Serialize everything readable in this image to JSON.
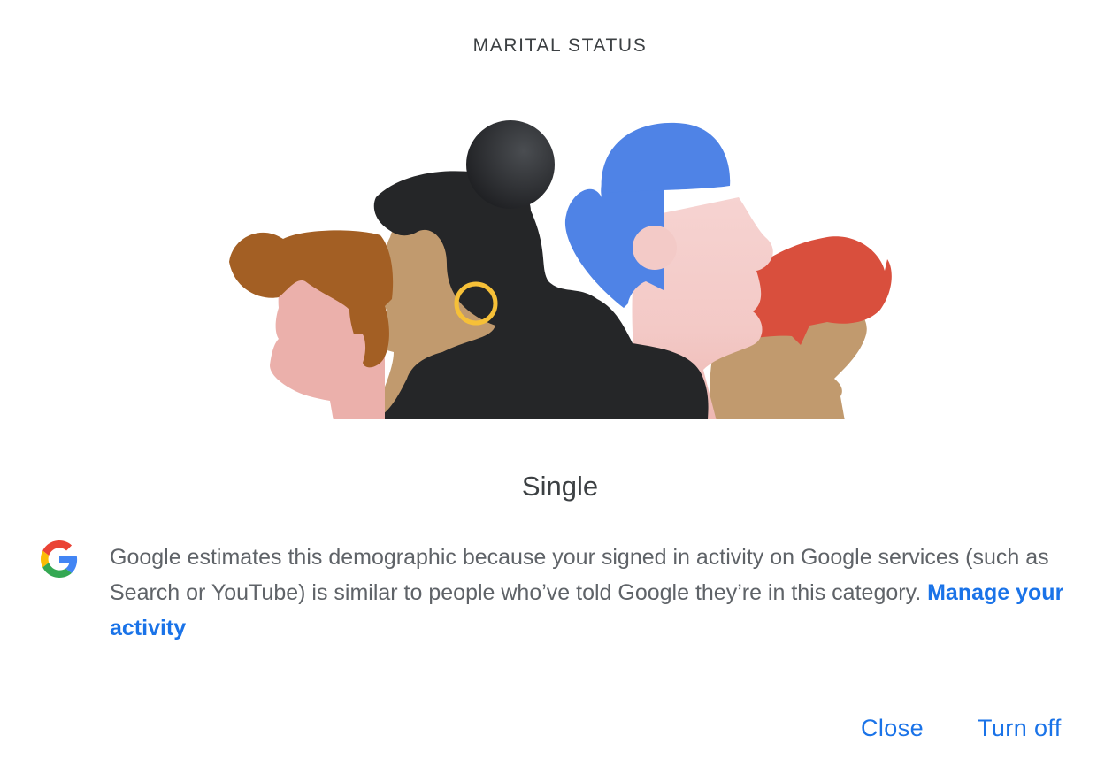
{
  "dialog": {
    "eyebrow": "MARITAL STATUS",
    "value": "Single",
    "description": "Google estimates this demographic because your signed in activity on Google services (such as Search or YouTube) is similar to people who’ve told Google they’re in this category. ",
    "manage_link": "Manage your activity",
    "close_label": "Close",
    "turn_off_label": "Turn off"
  },
  "icons": {
    "logo": "google-g-icon",
    "illustration": "people-profiles-illustration"
  },
  "colors": {
    "accent": "#1a73e8",
    "text_primary": "#3c4043",
    "text_secondary": "#5f6368",
    "hair_blue": "#4f83e6",
    "hair_red": "#d94f3d",
    "hair_brown": "#a35f24",
    "hair_black": "#252628",
    "earring": "#f6c038"
  }
}
